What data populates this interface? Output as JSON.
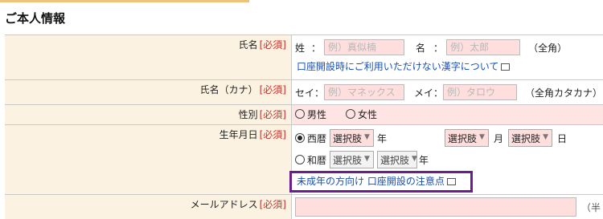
{
  "section": {
    "title": "ご本人情報"
  },
  "required_mark": "[必須]",
  "name_row": {
    "label": "氏名",
    "last_label": "姓",
    "last_placeholder": "例）真似楠",
    "first_label": "名",
    "first_placeholder": "例）太郎",
    "note": "（全角）",
    "help_link": "口座開設時にご利用いただけない漢字について"
  },
  "kana_row": {
    "label": "氏名（カナ）",
    "last_label": "セイ：",
    "last_placeholder": "例）マネックス",
    "first_label": "メイ：",
    "first_placeholder": "例）タロウ",
    "note": "（全角カタカナ）"
  },
  "gender_row": {
    "label": "性別",
    "options": [
      "男性",
      "女性"
    ]
  },
  "birth_row": {
    "label": "生年月日",
    "western_label": "西暦",
    "japanese_label": "和暦",
    "select_text": "選択肢",
    "year_unit": "年",
    "month_unit": "月",
    "day_unit": "日",
    "minor_link": "未成年の方向け 口座開設の注意点"
  },
  "email_row": {
    "label": "メールアドレス",
    "note": "（半"
  }
}
